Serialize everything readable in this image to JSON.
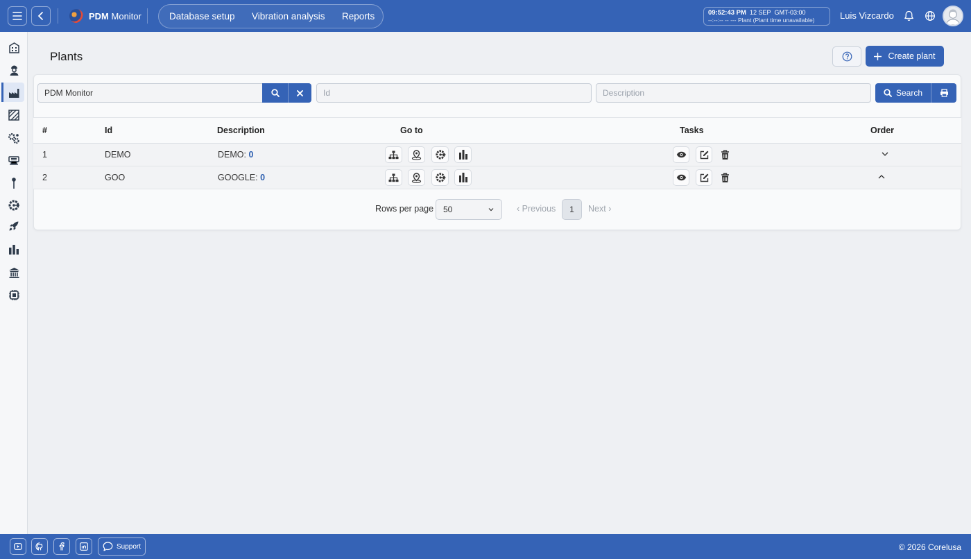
{
  "header": {
    "app_name_bold": "PDM",
    "app_name_rest": "Monitor",
    "nav": [
      "Database setup",
      "Vibration analysis",
      "Reports"
    ],
    "clock": {
      "time": "09:52:43 PM",
      "date": "12 SEP",
      "tz": "GMT-03:00",
      "plant_line": "--:--:-- -- ---  Plant (Plant time unavailable)"
    },
    "user_name": "Luis Vizcardo"
  },
  "sidebar": {
    "icons": [
      "building-icon",
      "worker-icon",
      "factory-icon",
      "area-icon",
      "gears-icon",
      "machine-icon",
      "point-icon",
      "sensor-icon",
      "rocket-icon",
      "bar-chart-icon",
      "institution-icon",
      "chip-icon"
    ],
    "active_index": 2
  },
  "page": {
    "title": "Plants",
    "create_label": "Create plant"
  },
  "filters": {
    "company_value": "PDM Monitor",
    "id_placeholder": "Id",
    "description_placeholder": "Description",
    "search_label": "Search"
  },
  "table": {
    "columns": [
      "#",
      "Id",
      "Description",
      "Go to",
      "Tasks",
      "Order"
    ],
    "rows": [
      {
        "index": "1",
        "id": "DEMO",
        "desc": "DEMO:",
        "count": "0",
        "order": "down"
      },
      {
        "index": "2",
        "id": "GOO",
        "desc": "GOOGLE:",
        "count": "0",
        "order": "up"
      }
    ]
  },
  "pagination": {
    "rows_label": "Rows per page",
    "rows_value": "50",
    "previous": "Previous",
    "page": "1",
    "next": "Next"
  },
  "footer": {
    "support_label": "Support",
    "copyright": "© 2026 Corelusa"
  },
  "colors": {
    "primary": "#3563b6",
    "background": "#eef0f3",
    "link_number": "#2d5fb0"
  }
}
